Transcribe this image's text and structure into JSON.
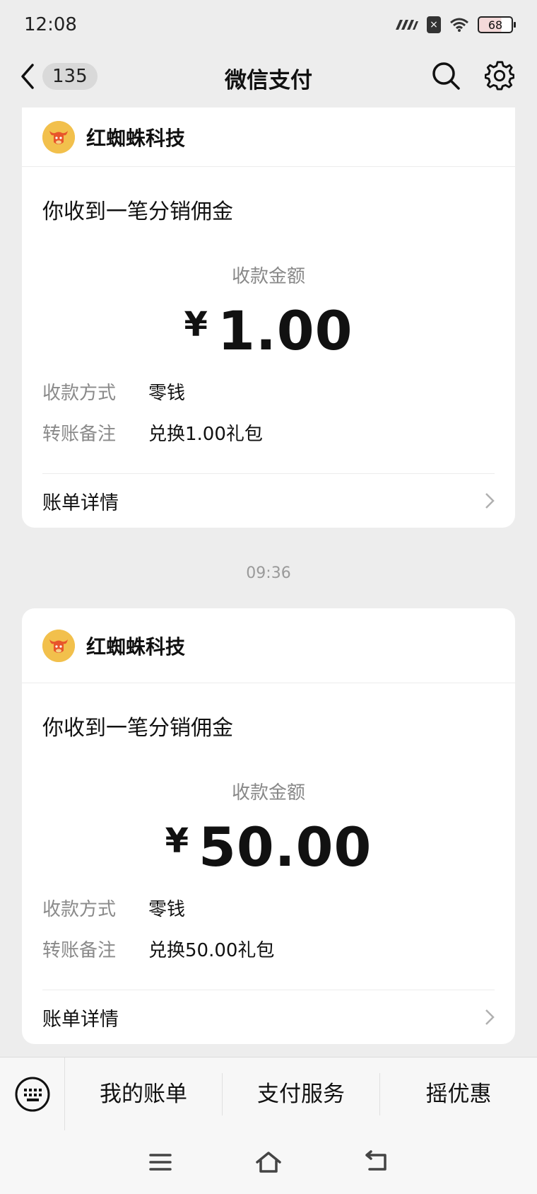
{
  "status_bar": {
    "time": "12:08",
    "battery": "68"
  },
  "nav": {
    "unread_count": "135",
    "title": "微信支付"
  },
  "messages": [
    {
      "merchant": "红蜘蛛科技",
      "title": "你收到一笔分销佣金",
      "amount_label": "收款金额",
      "currency": "¥",
      "amount": "1.00",
      "method_label": "收款方式",
      "method_value": "零钱",
      "note_label": "转账备注",
      "note_value": "兑换1.00礼包",
      "detail_label": "账单详情"
    },
    {
      "time": "09:36",
      "merchant": "红蜘蛛科技",
      "title": "你收到一笔分销佣金",
      "amount_label": "收款金额",
      "currency": "¥",
      "amount": "50.00",
      "method_label": "收款方式",
      "method_value": "零钱",
      "note_label": "转账备注",
      "note_value": "兑换50.00礼包",
      "detail_label": "账单详情"
    }
  ],
  "bottom_menu": {
    "keyboard_icon": "keyboard-icon",
    "items": [
      "我的账单",
      "支付服务",
      "摇优惠"
    ]
  },
  "icons": {
    "back": "back-chevron-icon",
    "search": "search-icon",
    "settings": "gear-icon",
    "menu": "menu-icon",
    "home": "home-icon",
    "return": "return-icon"
  }
}
